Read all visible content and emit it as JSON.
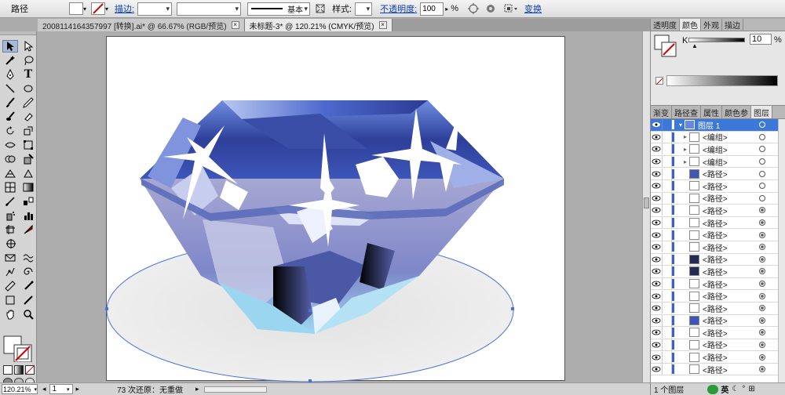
{
  "control_bar": {
    "object_type": "路径",
    "stroke_label": "描边:",
    "brush_label": "基本",
    "style_label": "样式:",
    "opacity_label": "不透明度:",
    "opacity_value": "100",
    "opacity_unit": "%",
    "transform_link": "变换"
  },
  "doc_tabs": [
    {
      "label": "2008114164357997 [转换].ai* @ 66.67% (RGB/预览)",
      "active": false
    },
    {
      "label": "未标题-3* @ 120.21% (CMYK/预览)",
      "active": true
    }
  ],
  "status_bar": {
    "zoom": "120.21%",
    "page": "1",
    "undo_text": "73 次还原：无重做"
  },
  "color_panel": {
    "tabs": [
      "透明度",
      "颜色",
      "外观",
      "描边"
    ],
    "active_tab": "颜色",
    "k_label": "K",
    "k_value": "10",
    "k_unit": "%"
  },
  "layers_panel": {
    "tabs": [
      "渐变",
      "路径查",
      "属性",
      "颜色参",
      "图层"
    ],
    "active_tab": "图层",
    "top_layer": "图层 1",
    "items": [
      {
        "label": "<编组>",
        "expandable": true,
        "ring": "empty"
      },
      {
        "label": "<编组>",
        "expandable": true,
        "ring": "empty"
      },
      {
        "label": "<编组>",
        "expandable": true,
        "ring": "empty"
      },
      {
        "label": "<路径>",
        "thumb": "blue",
        "ring": "empty"
      },
      {
        "label": "<路径>",
        "thumb": "white",
        "ring": "empty"
      },
      {
        "label": "<路径>",
        "thumb": "white",
        "ring": "empty"
      },
      {
        "label": "<路径>",
        "thumb": "white",
        "ring": "filled"
      },
      {
        "label": "<路径>",
        "thumb": "white",
        "ring": "filled"
      },
      {
        "label": "<路径>",
        "thumb": "white",
        "ring": "filled"
      },
      {
        "label": "<路径>",
        "thumb": "white",
        "ring": "filled"
      },
      {
        "label": "<路径>",
        "thumb": "dark",
        "ring": "filled"
      },
      {
        "label": "<路径>",
        "thumb": "dark",
        "ring": "filled"
      },
      {
        "label": "<路径>",
        "thumb": "white",
        "ring": "filled"
      },
      {
        "label": "<路径>",
        "thumb": "white",
        "ring": "filled"
      },
      {
        "label": "<路径>",
        "thumb": "white",
        "ring": "filled"
      },
      {
        "label": "<路径>",
        "thumb": "blue",
        "ring": "filled"
      },
      {
        "label": "<路径>",
        "thumb": "white",
        "ring": "filled"
      },
      {
        "label": "<路径>",
        "thumb": "white",
        "ring": "filled"
      },
      {
        "label": "<路径>",
        "thumb": "white",
        "ring": "filled"
      },
      {
        "label": "<路径>",
        "thumb": "white",
        "ring": "filled"
      }
    ],
    "footer": "1 个图层"
  },
  "colors": {
    "accent": "#3c78d8",
    "diamond_dark": "#2a3a8c",
    "diamond_mid": "#4a64c4",
    "selection": "#4a72d8"
  }
}
